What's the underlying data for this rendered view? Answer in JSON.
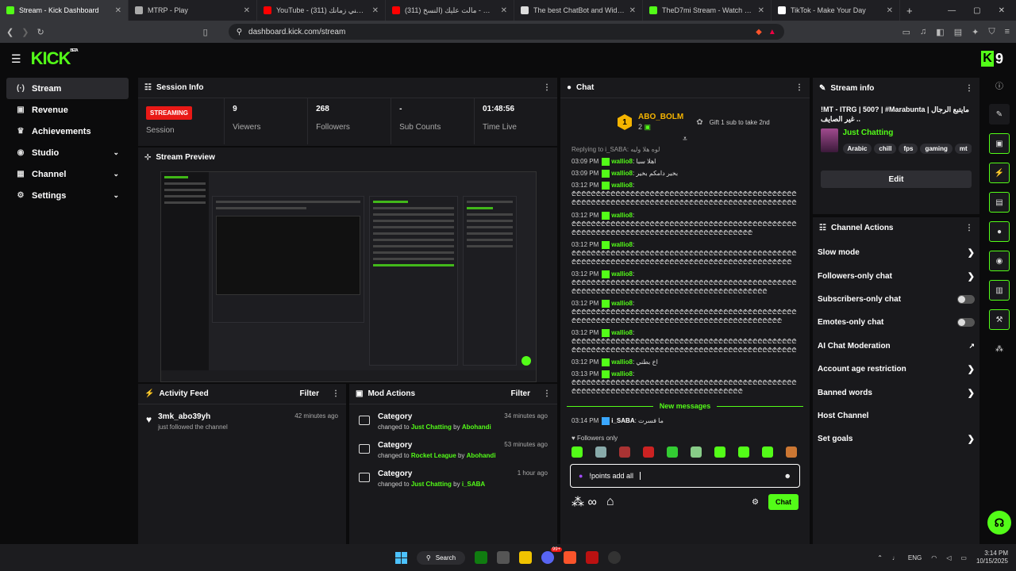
{
  "browser": {
    "tabs": [
      {
        "label": "Stream - Kick Dashboard",
        "color": "#53fc18",
        "active": true
      },
      {
        "label": "MTRP - Play",
        "color": "#aaaaaa"
      },
      {
        "label": "YouTube - واحشني زمانك (311)",
        "color": "#ff0000"
      },
      {
        "label": "(311) بدر الشعيبي - مالت عليك (النسخ",
        "color": "#ff0000"
      },
      {
        "label": "The best ChatBot and Widgets for K",
        "color": "#dddddd"
      },
      {
        "label": "TheD7mi Stream - Watch Live on Kic",
        "color": "#53fc18"
      },
      {
        "label": "TikTok - Make Your Day",
        "color": "#ffffff"
      }
    ],
    "url": "dashboard.kick.com/stream"
  },
  "header": {
    "logo": "KICK",
    "logo_sup": "BETA",
    "avatar_text": "9"
  },
  "sidebar": [
    {
      "label": "Stream",
      "icon": "(·)",
      "active": true,
      "chev": ""
    },
    {
      "label": "Revenue",
      "icon": "▣",
      "chev": ""
    },
    {
      "label": "Achievements",
      "icon": "♛",
      "chev": ""
    },
    {
      "label": "Studio",
      "icon": "◉",
      "chev": "⌄"
    },
    {
      "label": "Channel",
      "icon": "▦",
      "chev": "⌄"
    },
    {
      "label": "Settings",
      "icon": "⚙",
      "chev": "⌄"
    }
  ],
  "session": {
    "title": "Session Info",
    "badge": "STREAMING",
    "badge_label": "Session",
    "stats": [
      {
        "value": "9",
        "label": "Viewers"
      },
      {
        "value": "268",
        "label": "Followers"
      },
      {
        "value": "-",
        "label": "Sub Counts"
      },
      {
        "value": "01:48:56",
        "label": "Time Live"
      }
    ]
  },
  "preview": {
    "title": "Stream Preview"
  },
  "activity": {
    "title": "Activity Feed",
    "filter": "Filter",
    "item": {
      "name": "3mk_abo39yh",
      "sub": "just followed the channel",
      "time": "42 minutes ago"
    }
  },
  "mod": {
    "title": "Mod Actions",
    "filter": "Filter",
    "items": [
      {
        "title": "Category",
        "pre": "changed to",
        "cat": "Just Chatting",
        "by": "by",
        "user": "Abohandi",
        "time": "34 minutes ago"
      },
      {
        "title": "Category",
        "pre": "changed to",
        "cat": "Rocket League",
        "by": "by",
        "user": "Abohandi",
        "time": "53 minutes ago"
      },
      {
        "title": "Category",
        "pre": "changed to",
        "cat": "Just Chatting",
        "by": "by",
        "user": "i_SABA",
        "time": "1 hour ago"
      }
    ]
  },
  "chat": {
    "title": "Chat",
    "top_user": "ABO_BOLM",
    "top_rank": "1",
    "top_count": "2",
    "gift": "Gift 1 sub to take 2nd",
    "reply": "Replying to i_SABA: لوه هلا وليه",
    "messages": [
      {
        "t": "03:09 PM",
        "u": "wallio8",
        "b": "اهلا سبا"
      },
      {
        "t": "03:09 PM",
        "u": "wallio8",
        "b": "بخير دامكم بخير"
      },
      {
        "t": "03:12 PM",
        "u": "wallio8",
        "b": "₾₾₾₾₾₾₾₾₾₾₾₾₾₾₾₾₾₾₾₾₾₾₾₾₾₾₾₾₾₾₾₾₾₾₾₾₾₾₾₾₾₾₾₾₾₾₾₾₾₾₾₾₾₾₾₾₾₾₾₾₾₾₾₾₾₾₾₾₾₾₾₾₾₾₾₾₾₾₾₾₾₾₾₾₾₾₾₾₾₾₾₾₾₾₾₾₾₾₾₾₾₾₾₾₾₾₾₾₾₾₾₾"
      },
      {
        "t": "03:12 PM",
        "u": "wallio8",
        "b": "₾₾₾₾₾₾₾₾₾₾₾₾₾₾₾₾₾₾₾₾₾₾₾₾₾₾₾₾₾₾₾₾₾₾₾₾₾₾₾₾₾₾₾₾₾₾₾₾₾₾₾₾₾₾₾₾₾₾₾₾₾₾₾₾₾₾₾₾₾₾₾₾₾₾₾₾₾₾₾₾₾₾₾"
      },
      {
        "t": "03:12 PM",
        "u": "wallio8",
        "b": "₾₾₾₾₾₾₾₾₾₾₾₾₾₾₾₾₾₾₾₾₾₾₾₾₾₾₾₾₾₾₾₾₾₾₾₾₾₾₾₾₾₾₾₾₾₾₾₾₾₾₾₾₾₾₾₾₾₾₾₾₾₾₾₾₾₾₾₾₾₾₾₾₾₾₾₾₾₾₾₾₾₾₾₾₾₾₾₾₾₾₾"
      },
      {
        "t": "03:12 PM",
        "u": "wallio8",
        "b": "₾₾₾₾₾₾₾₾₾₾₾₾₾₾₾₾₾₾₾₾₾₾₾₾₾₾₾₾₾₾₾₾₾₾₾₾₾₾₾₾₾₾₾₾₾₾₾₾₾₾₾₾₾₾₾₾₾₾₾₾₾₾₾₾₾₾₾₾₾₾₾₾₾₾₾₾₾₾₾₾₾₾₾₾₾₾"
      },
      {
        "t": "03:12 PM",
        "u": "wallio8",
        "b": "₾₾₾₾₾₾₾₾₾₾₾₾₾₾₾₾₾₾₾₾₾₾₾₾₾₾₾₾₾₾₾₾₾₾₾₾₾₾₾₾₾₾₾₾₾₾₾₾₾₾₾₾₾₾₾₾₾₾₾₾₾₾₾₾₾₾₾₾₾₾₾₾₾₾₾₾₾₾₾₾₾₾₾₾₾₾₾₾₾"
      },
      {
        "t": "03:12 PM",
        "u": "wallio8",
        "b": "₾₾₾₾₾₾₾₾₾₾₾₾₾₾₾₾₾₾₾₾₾₾₾₾₾₾₾₾₾₾₾₾₾₾₾₾₾₾₾₾₾₾₾₾₾₾₾₾₾₾₾₾₾₾₾₾₾₾₾₾₾₾₾₾₾₾₾₾₾₾₾₾₾₾₾₾₾₾₾₾₾₾₾₾₾₾₾₾₾₾₾₾"
      },
      {
        "t": "03:12 PM",
        "u": "wallio8",
        "b": "اخ بطني"
      },
      {
        "t": "03:13 PM",
        "u": "wallio8",
        "b": "₾₾₾₾₾₾₾₾₾₾₾₾₾₾₾₾₾₾₾₾₾₾₾₾₾₾₾₾₾₾₾₾₾₾₾₾₾₾₾₾₾₾₾₾₾₾₾₾₾₾₾₾₾₾₾₾₾₾₾₾₾₾₾₾₾₾₾₾₾₾₾₾₾₾₾₾₾₾₾₾₾"
      }
    ],
    "new_messages": "New messages",
    "last": {
      "t": "03:14 PM",
      "u": "i_SABA",
      "b": "ما فسرت"
    },
    "followers_only": "Followers only",
    "input": "!points add all",
    "send": "Chat"
  },
  "stream_info": {
    "title": "Stream info",
    "stream_title": "!MT - ITRG | 500? | #Marabunta | مايتبع الرجال غير الصايف ..",
    "category": "Just Chatting",
    "tags": [
      "Arabic",
      "chill",
      "fps",
      "gaming",
      "mt"
    ],
    "edit": "Edit"
  },
  "channel_actions": {
    "title": "Channel Actions",
    "items": [
      {
        "label": "Slow mode",
        "ctl": "chev"
      },
      {
        "label": "Followers-only chat",
        "ctl": "chev"
      },
      {
        "label": "Subscribers-only chat",
        "ctl": "toggle"
      },
      {
        "label": "Emotes-only chat",
        "ctl": "toggle"
      },
      {
        "label": "AI Chat Moderation",
        "ctl": "ext"
      },
      {
        "label": "Account age restriction",
        "ctl": "chev"
      },
      {
        "label": "Banned words",
        "ctl": "chev"
      },
      {
        "label": "Host Channel",
        "ctl": "none"
      },
      {
        "label": "Set goals",
        "ctl": "chev"
      }
    ]
  },
  "taskbar": {
    "search": "Search",
    "lang": "ENG",
    "time": "3:14 PM",
    "date": "10/15/2025",
    "badge": "99+"
  }
}
